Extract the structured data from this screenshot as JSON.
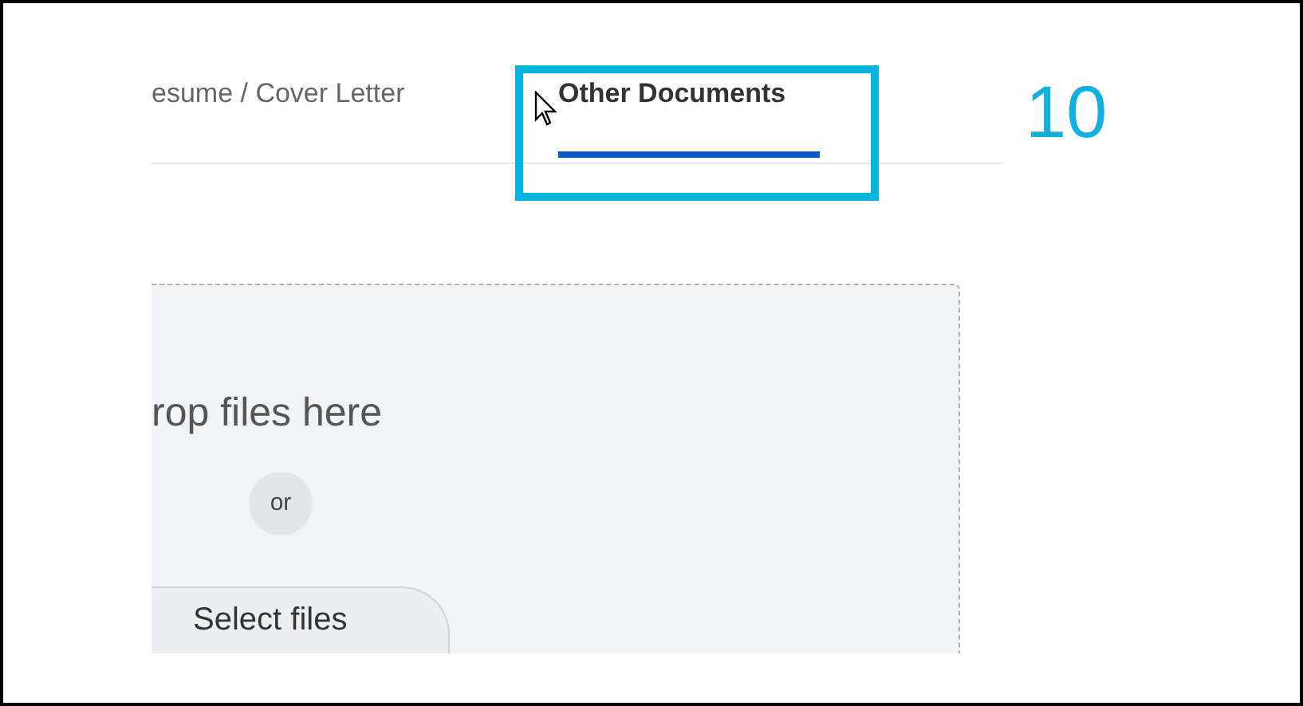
{
  "tabs": [
    {
      "label": "esume / Cover Letter",
      "selected": false
    },
    {
      "label": "Other Documents",
      "selected": true
    }
  ],
  "annotation": {
    "number": "10"
  },
  "drop_zone": {
    "prompt": "rop files here",
    "separator": "or",
    "button": "Select files"
  }
}
